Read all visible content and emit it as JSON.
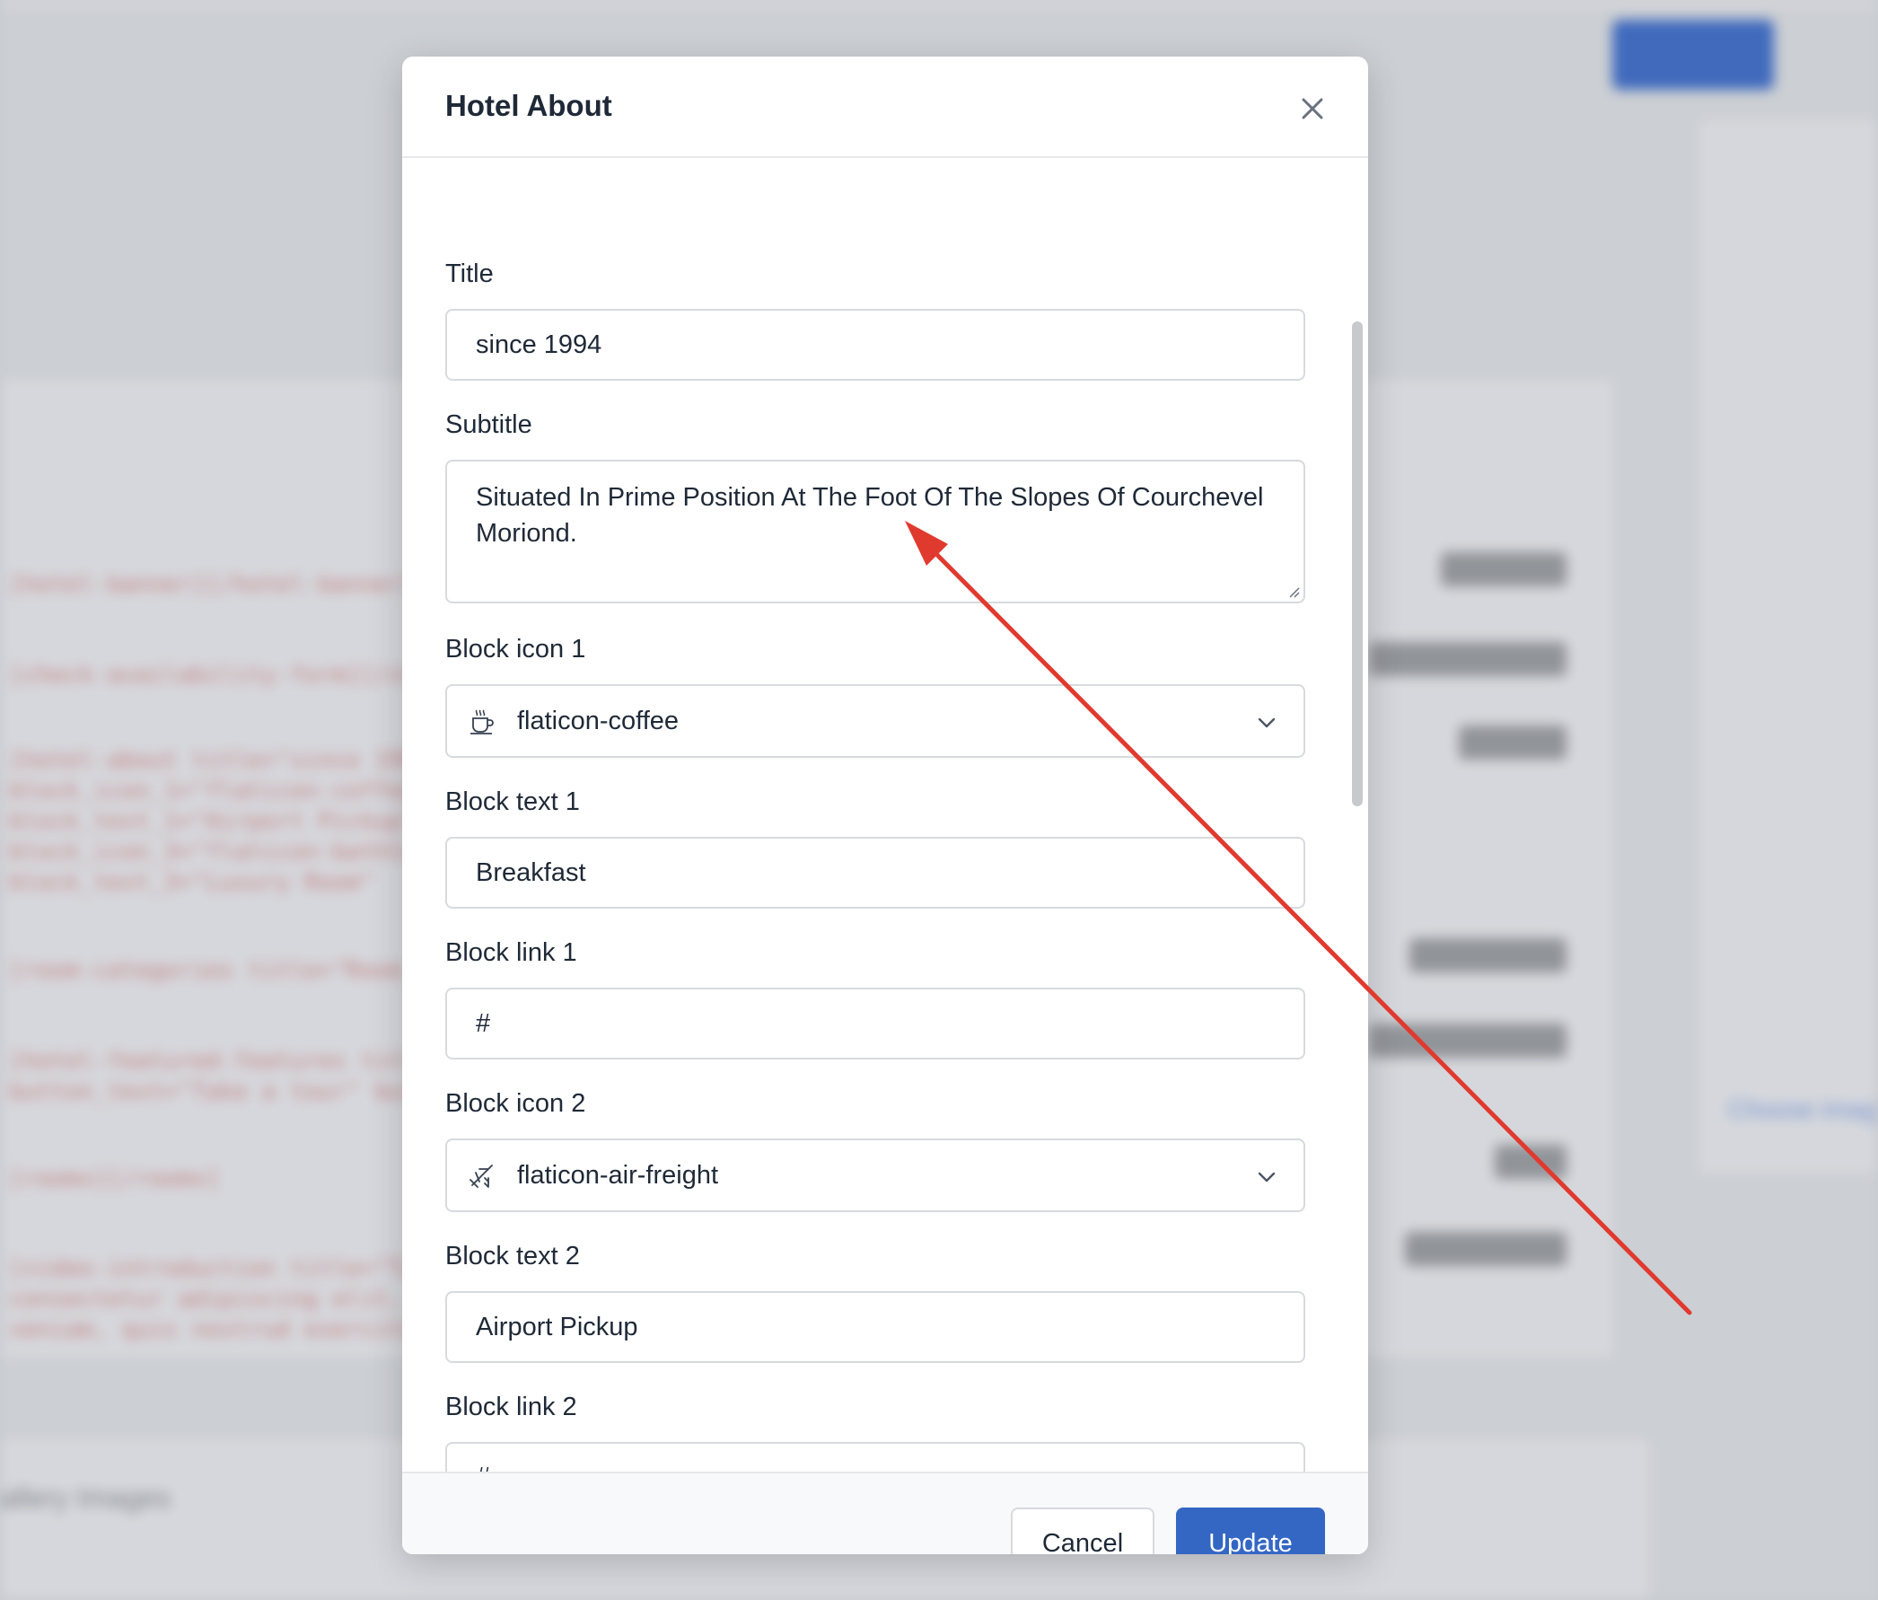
{
  "modal": {
    "title": "Hotel About",
    "fields": {
      "title": {
        "label": "Title",
        "value": "since 1994"
      },
      "subtitle": {
        "label": "Subtitle",
        "value": "Situated In Prime Position At The Foot Of The Slopes Of Courchevel Moriond."
      },
      "block_icon_1": {
        "label": "Block icon 1",
        "value": "flaticon-coffee",
        "icon": "coffee-icon"
      },
      "block_text_1": {
        "label": "Block text 1",
        "value": "Breakfast"
      },
      "block_link_1": {
        "label": "Block link 1",
        "value": "#"
      },
      "block_icon_2": {
        "label": "Block icon 2",
        "value": "flaticon-air-freight",
        "icon": "air-freight-icon"
      },
      "block_text_2": {
        "label": "Block text 2",
        "value": "Airport Pickup"
      },
      "block_link_2": {
        "label": "Block link 2",
        "value": "#"
      }
    },
    "footer": {
      "cancel_label": "Cancel",
      "update_label": "Update"
    }
  },
  "colors": {
    "primary": "#3467c4",
    "annotation_arrow": "#e03a2f"
  }
}
